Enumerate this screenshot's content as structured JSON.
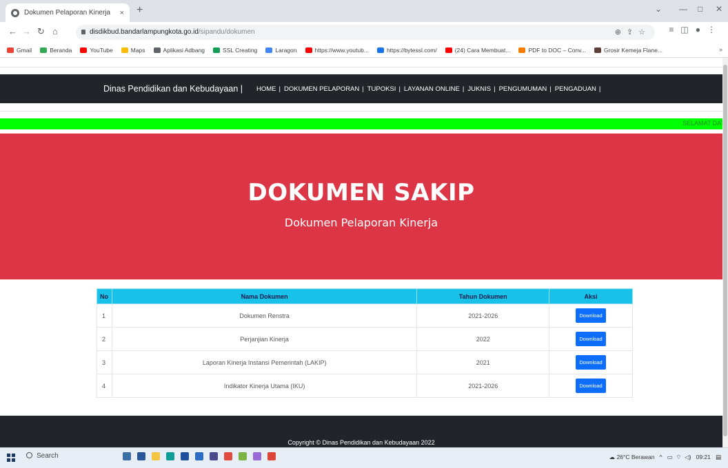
{
  "browser": {
    "tab_title": "Dokumen Pelaporan Kinerja",
    "tab_close": "×",
    "new_tab": "+",
    "url_domain": "disdikbud.bandarlampungkota.go.id",
    "url_path": "/sipandu/dokumen",
    "bookmarks": [
      {
        "label": "Gmail",
        "color": "#ea4335"
      },
      {
        "label": "Beranda",
        "color": "#34a853"
      },
      {
        "label": "YouTube",
        "color": "#ff0000"
      },
      {
        "label": "Maps",
        "color": "#fbbc05"
      },
      {
        "label": "Aplikasi Adbang",
        "color": "#5f6368"
      },
      {
        "label": "SSL Creating",
        "color": "#0f9d58"
      },
      {
        "label": "Laragon",
        "color": "#4285f4"
      },
      {
        "label": "https://www.youtub...",
        "color": "#ff0000"
      },
      {
        "label": "https://bytessl.com/",
        "color": "#1a73e8"
      },
      {
        "label": "(24) Cara Membuat...",
        "color": "#ff0000"
      },
      {
        "label": "PDF to DOC – Conv...",
        "color": "#f57c00"
      },
      {
        "label": "Grosir Kemeja Flane...",
        "color": "#5d4037"
      }
    ],
    "bookmarks_more": "»"
  },
  "navbar": {
    "brand": "Dinas Pendidikan dan Kebudayaan |",
    "menu": [
      "HOME",
      "DOKUMEN PELAPORAN",
      "TUPOKSI",
      "LAYANAN ONLINE",
      "JUKNIS",
      "PENGUMUMAN",
      "PENGADUAN"
    ],
    "separator": "|"
  },
  "marquee": {
    "text": "SELAMAT DAT"
  },
  "hero": {
    "title": "DOKUMEN SAKIP",
    "subtitle": "Dokumen Pelaporan Kinerja",
    "color": "#dc3545"
  },
  "table": {
    "headers": [
      "No",
      "Nama Dokumen",
      "Tahun Dokumen",
      "Aksi"
    ],
    "rows": [
      {
        "no": "1",
        "nama": "Dokumen Renstra",
        "tahun": "2021-2026",
        "aksi": "Download"
      },
      {
        "no": "2",
        "nama": "Perjanjian Kinerja",
        "tahun": "2022",
        "aksi": "Download"
      },
      {
        "no": "3",
        "nama": "Laporan Kinerja Instansi Pemerintah (LAKIP)",
        "tahun": "2021",
        "aksi": "Download"
      },
      {
        "no": "4",
        "nama": "Indikator Kinerja Utama (IKU)",
        "tahun": "2021-2026",
        "aksi": "Download"
      }
    ]
  },
  "footer": {
    "copyright": "Copyright © Dinas Pendidikan dan Kebudayaan 2022"
  },
  "taskbar": {
    "search_label": "Search",
    "weather": "26°C Berawan",
    "time": "09:21"
  },
  "icons": {
    "back": "back-arrow-icon",
    "forward": "forward-arrow-icon",
    "reload": "reload-icon",
    "home": "home-icon",
    "lock": "lock-icon",
    "windows": "windows-start-icon"
  }
}
